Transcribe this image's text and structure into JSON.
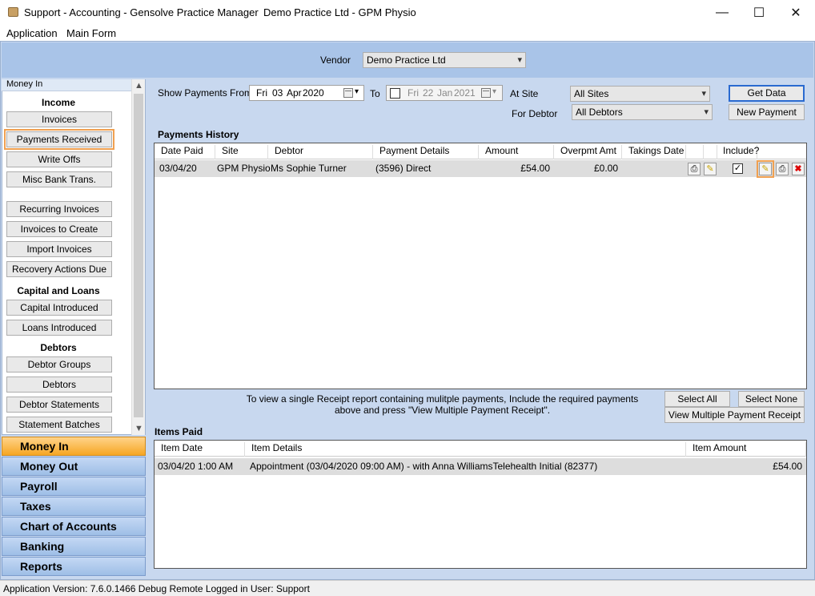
{
  "window": {
    "title": "Support - Accounting - Gensolve Practice Manager",
    "subtitle": "Demo Practice Ltd - GPM Physio",
    "minimize": "—",
    "maximize": "☐",
    "close": "✕"
  },
  "menu": [
    "Application",
    "Main Form"
  ],
  "vendor": {
    "label": "Vendor",
    "value": "Demo Practice Ltd"
  },
  "left_panel": {
    "header": "Money In",
    "sections": {
      "income": "Income",
      "capital": "Capital and Loans",
      "debtors": "Debtors"
    },
    "buttons": [
      "Invoices",
      "Payments Received",
      "Write Offs",
      "Misc Bank Trans.",
      "Recurring Invoices",
      "Invoices to Create",
      "Import Invoices",
      "Recovery Actions Due",
      "Capital Introduced",
      "Loans Introduced",
      "Debtor Groups",
      "Debtors",
      "Debtor Statements",
      "Statement Batches"
    ]
  },
  "outlook_bar": [
    "Money In",
    "Money Out",
    "Payroll",
    "Taxes",
    "Chart of Accounts",
    "Banking",
    "Reports"
  ],
  "filters": {
    "show_from_label": "Show Payments From",
    "from_date": {
      "day": "Fri",
      "date": "03",
      "month": "Apr",
      "year": "2020"
    },
    "to_label": "To",
    "to_date": {
      "day": "Fri",
      "date": "22",
      "month": "Jan",
      "year": "2021"
    },
    "site_label": "At Site",
    "site_value": "All Sites",
    "debtor_label": "For Debtor",
    "debtor_value": "All Debtors",
    "get_data": "Get Data",
    "new_payment": "New Payment"
  },
  "payments_history": {
    "title": "Payments History",
    "columns": [
      "Date Paid",
      "Site",
      "Debtor",
      "Payment Details",
      "Amount",
      "Overpmt Amt",
      "Takings Date",
      "Include?"
    ],
    "rows": [
      {
        "date_paid": "03/04/20",
        "site": "GPM Physio",
        "debtor": "Ms Sophie Turner",
        "details": "(3596) Direct",
        "amount": "£54.00",
        "overpmt": "£0.00",
        "takings_date": "",
        "include": true
      }
    ]
  },
  "notice": "To view a single Receipt report containing mulitple payments, Include the required payments above and press \"View Multiple Payment Receipt\".",
  "actions": {
    "select_all": "Select All",
    "select_none": "Select None",
    "view_multiple": "View Multiple Payment Receipt"
  },
  "items_paid": {
    "title": "Items Paid",
    "columns": [
      "Item Date",
      "Item Details",
      "Item Amount"
    ],
    "rows": [
      {
        "date": "03/04/20 1:00 AM",
        "details": "Appointment (03/04/2020 09:00 AM) - with Anna WilliamsTelehealth Initial (82377)",
        "amount": "£54.00"
      }
    ]
  },
  "status": "Application Version: 7.6.0.1466 Debug Remote  Logged in User: Support",
  "icons": {
    "report": "⎙",
    "pencil": "✎",
    "delete": "✖",
    "check": "✓",
    "dropdown": "▾",
    "scroll_up": "▲",
    "scroll_down": "▼"
  },
  "colors": {
    "active_module": "#f6a623",
    "module_blue": "#9ebee6",
    "highlight": "#f0a050"
  }
}
